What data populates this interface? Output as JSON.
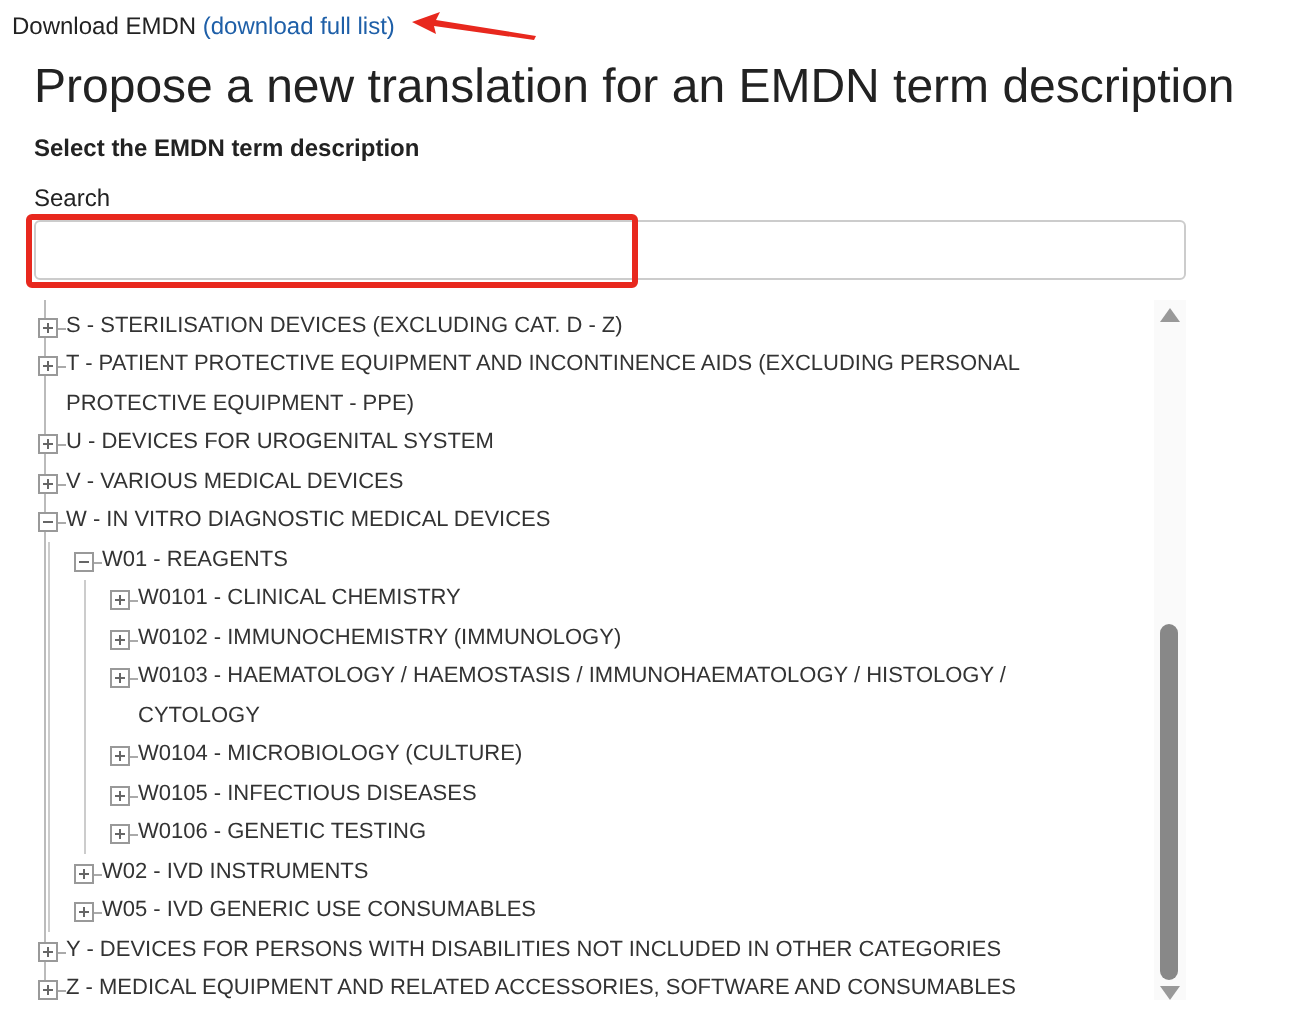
{
  "header": {
    "text": "Download EMDN",
    "link": "(download full list)",
    "arrow_marked": true
  },
  "title": "Propose a new translation for an EMDN term description",
  "subtitle": "Select the EMDN term description",
  "search": {
    "label": "Search",
    "highlighted": true
  },
  "tree": [
    {
      "label": "S - STERILISATION DEVICES (EXCLUDING CAT. D - Z)",
      "expanded": false
    },
    {
      "label": "T - PATIENT PROTECTIVE EQUIPMENT AND INCONTINENCE AIDS (EXCLUDING PERSONAL PROTECTIVE EQUIPMENT - PPE)",
      "expanded": false
    },
    {
      "label": "U - DEVICES FOR UROGENITAL SYSTEM",
      "expanded": false
    },
    {
      "label": "V - VARIOUS MEDICAL DEVICES",
      "expanded": false
    },
    {
      "label": "W - IN VITRO DIAGNOSTIC MEDICAL DEVICES",
      "expanded": true,
      "children": [
        {
          "label": "W01 - REAGENTS",
          "expanded": true,
          "children": [
            {
              "label": "W0101 - CLINICAL CHEMISTRY",
              "expanded": false
            },
            {
              "label": "W0102 - IMMUNOCHEMISTRY (IMMUNOLOGY)",
              "expanded": false
            },
            {
              "label": "W0103 - HAEMATOLOGY / HAEMOSTASIS / IMMUNOHAEMATOLOGY / HISTOLOGY / CYTOLOGY",
              "expanded": false
            },
            {
              "label": "W0104 - MICROBIOLOGY (CULTURE)",
              "expanded": false
            },
            {
              "label": "W0105 - INFECTIOUS DISEASES",
              "expanded": false
            },
            {
              "label": "W0106 - GENETIC TESTING",
              "expanded": false
            }
          ]
        },
        {
          "label": "W02 - IVD INSTRUMENTS",
          "expanded": false
        },
        {
          "label": "W05 - IVD GENERIC USE CONSUMABLES",
          "expanded": false
        }
      ]
    },
    {
      "label": "Y - DEVICES FOR PERSONS WITH DISABILITIES NOT INCLUDED IN OTHER CATEGORIES",
      "expanded": false
    },
    {
      "label": "Z - MEDICAL EQUIPMENT AND RELATED ACCESSORIES, SOFTWARE AND CONSUMABLES",
      "expanded": false
    }
  ]
}
